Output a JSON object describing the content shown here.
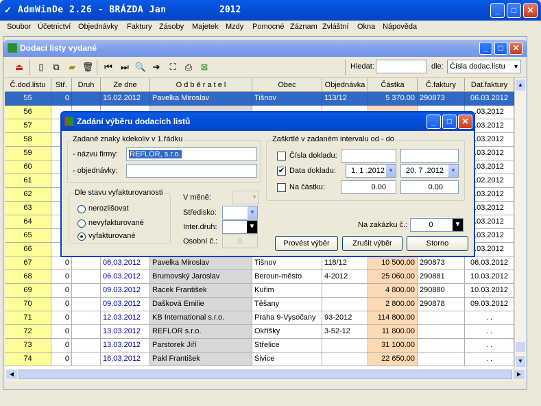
{
  "app": {
    "title": "AdmWinDe 2.26 - BRÁZDA Jan",
    "year": "2012",
    "icon": "app-icon"
  },
  "menu": [
    "Soubor",
    "Účetnictví",
    "Objednávky",
    "Faktury",
    "Zásoby",
    "Majetek",
    "Mzdy",
    "Pomocné",
    "Záznam",
    "Zvláštní",
    "Okna",
    "Nápověda"
  ],
  "child": {
    "title": "Dodací listy vydané"
  },
  "toolbar": {
    "search_label": "Hledat:",
    "search_value": "",
    "by_label": "dle:",
    "by_value": "Čísla dodac.listu"
  },
  "columns": [
    "Č.dod.listu",
    "Stř.",
    "Druh",
    "Ze dne",
    "O d b ě r a t e l",
    "Obec",
    "Objednávka",
    "Částka",
    "Č.faktury",
    "Dat.faktury"
  ],
  "rows": [
    [
      "55",
      "0",
      "",
      "15.02.2012",
      "Pavelka Miroslav",
      "Tišnov",
      "113/12",
      "5 370.00",
      "290873",
      "06.03.2012"
    ],
    [
      "56",
      "",
      "",
      "",
      "",
      "",
      "",
      "",
      "",
      ".03.2012"
    ],
    [
      "57",
      "",
      "",
      "",
      "",
      "",
      "",
      "",
      "",
      ".03.2012"
    ],
    [
      "58",
      "",
      "",
      "",
      "",
      "",
      "",
      "",
      "",
      ".03.2012"
    ],
    [
      "59",
      "",
      "",
      "",
      "",
      "",
      "",
      "",
      "",
      ".03.2012"
    ],
    [
      "60",
      "",
      "",
      "",
      "",
      "",
      "",
      "",
      "",
      ".03.2012"
    ],
    [
      "61",
      "",
      "",
      "",
      "",
      "",
      "",
      "",
      "",
      ".02.2012"
    ],
    [
      "62",
      "",
      "",
      "",
      "",
      "",
      "",
      "",
      "",
      ".03.2012"
    ],
    [
      "63",
      "",
      "",
      "",
      "",
      "",
      "",
      "",
      "",
      ".03.2012"
    ],
    [
      "64",
      "",
      "",
      "",
      "",
      "",
      "",
      "",
      "",
      ".03.2012"
    ],
    [
      "65",
      "",
      "",
      "",
      "",
      "",
      "",
      "",
      "",
      ".03.2012"
    ],
    [
      "66",
      "",
      "",
      "",
      "",
      "",
      "",
      "",
      "",
      ".03.2012"
    ],
    [
      "67",
      "0",
      "",
      "06.03.2012",
      "Pavelka Miroslav",
      "Tišnov",
      "118/12",
      "10 500.00",
      "290873",
      "06.03.2012"
    ],
    [
      "68",
      "0",
      "",
      "06.03.2012",
      "Brumovský Jaroslav",
      "Beroun-město",
      "4-2012",
      "25 060.00",
      "290881",
      "10.03.2012"
    ],
    [
      "69",
      "0",
      "",
      "09.03.2012",
      "Racek František",
      "Kuřim",
      "",
      "4 800.00",
      "290880",
      "10.03.2012"
    ],
    [
      "70",
      "0",
      "",
      "09.03.2012",
      "Dašková Emilie",
      "Těšany",
      "",
      "2 800.00",
      "290878",
      "09.03.2012"
    ],
    [
      "71",
      "0",
      "",
      "12.03.2012",
      "KB International s.r.o.",
      "Praha 9-Vysočany",
      "93-2012",
      "114 800.00",
      "",
      ". ."
    ],
    [
      "72",
      "0",
      "",
      "13.03.2012",
      "REFLOR s.r.o.",
      "Okříšky",
      "3-52-12",
      "11 800.00",
      "",
      ". ."
    ],
    [
      "73",
      "0",
      "",
      "13.03.2012",
      "Parstorek Jiří",
      "Střelice",
      "",
      "31 100.00",
      "",
      ". ."
    ],
    [
      "74",
      "0",
      "",
      "16.03.2012",
      "Pakl František",
      "Sivice",
      "",
      "22 650.00",
      "",
      ". ."
    ]
  ],
  "dialog": {
    "title": "Zadání výběru dodacích listů",
    "group_names": "Zadané znaky kdekoliv v 1.řádku",
    "firm_label": "- názvu firmy:",
    "firm_value": "REFLOR, s.r.o.",
    "order_label": "- objednávky:",
    "order_value": "",
    "group_interval": "Zaškrtlé v zadaném intervalu od - do",
    "doc_num_label": "Čísla dokladu:",
    "doc_num_from": "",
    "doc_num_to": "",
    "doc_date_label": "Data dokladu:",
    "doc_date_from": "1. 1 .2012",
    "doc_date_to": "20. 7 .2012",
    "amount_label": "Na částku:",
    "amount_from": "0.00",
    "amount_to": "0.00",
    "group_invoice": "Dle stavu vyfakturovanosti",
    "radio_1": "nerozlišovat",
    "radio_2": "nevyfakturované",
    "radio_3": "vyfakturované",
    "currency_label": "V měně:",
    "center_label": "Středisko:",
    "inter_label": "Inter.druh:",
    "personal_label": "Osobní č.:",
    "personal_value": "0",
    "order_no_label": "Na zakázku č.:",
    "order_no_value": "0",
    "btn_run": "Provést výběr",
    "btn_cancel_sel": "Zrušit výběr",
    "btn_storno": "Storno"
  }
}
